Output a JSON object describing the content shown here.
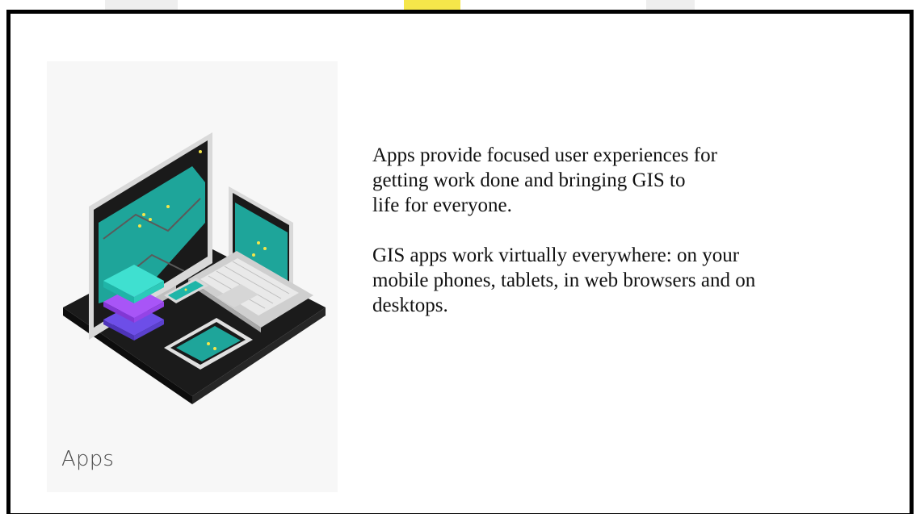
{
  "card": {
    "label": "Apps",
    "illustration_icon": "devices-map-illustration-icon"
  },
  "paragraphs": [
    {
      "lines": [
        "Apps provide focused user experiences for",
        "getting work done and bringing GIS to",
        "life for everyone."
      ]
    },
    {
      "lines": [
        "GIS apps work virtually everywhere: on your",
        "mobile phones, tablets, in web browsers and on",
        "desktops."
      ]
    }
  ],
  "colors": {
    "frame": "#000000",
    "card_background": "#f7f7f7",
    "screen_accent": "#1fb5a8",
    "layer_top": "#3fe0d0",
    "layer_mid": "#a855f7",
    "layer_bottom": "#6d4ee8",
    "top_strip_accent": "#f5e64a"
  }
}
